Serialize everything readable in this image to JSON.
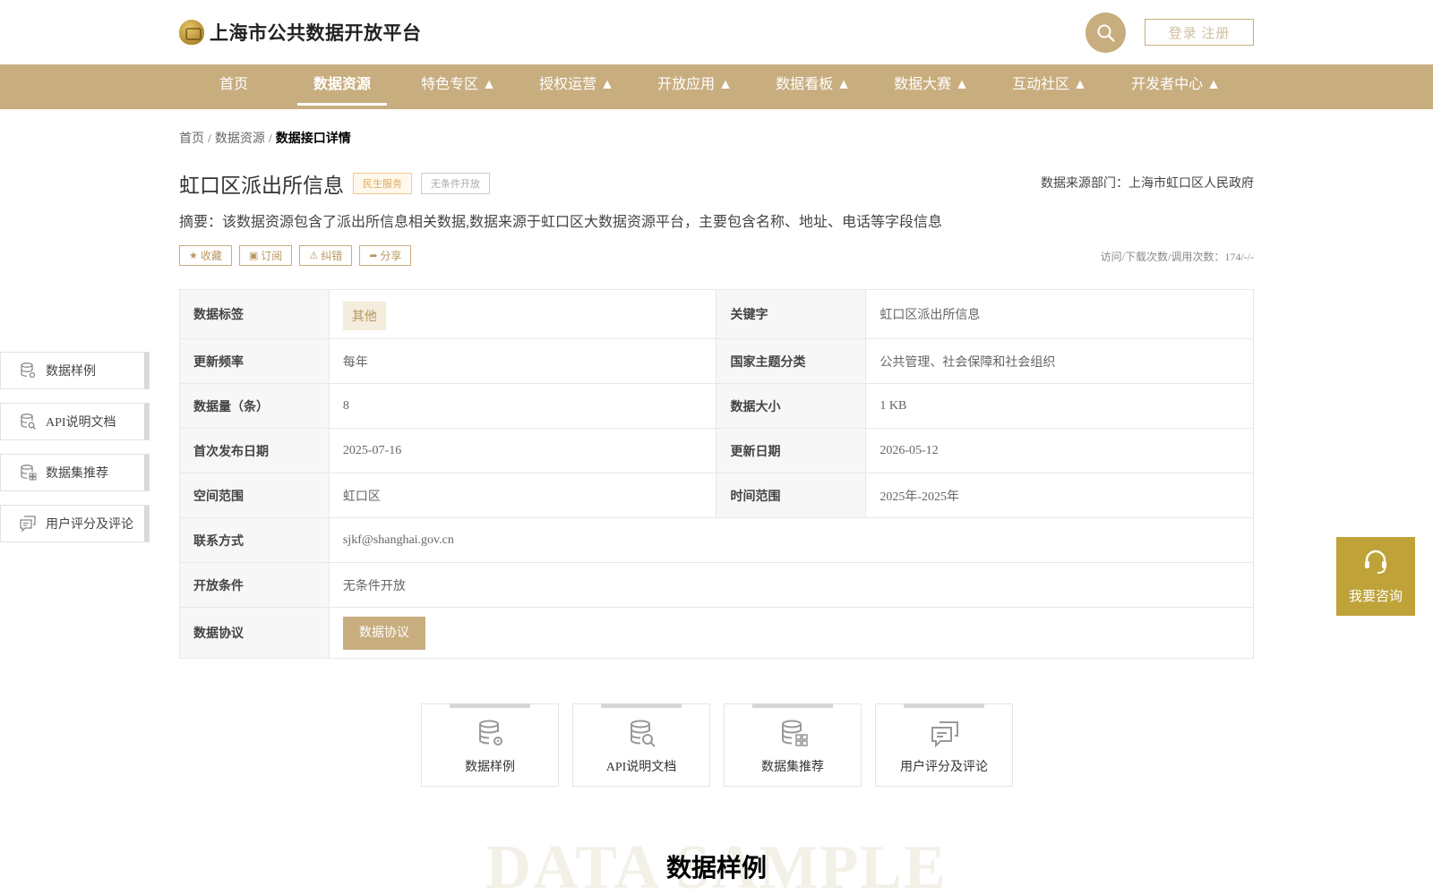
{
  "header": {
    "site_title": "上海市公共数据开放平台",
    "login_label": "登录 注册"
  },
  "nav": {
    "items": [
      {
        "label": "首页"
      },
      {
        "label": "数据资源"
      },
      {
        "label": "特色专区 ▲"
      },
      {
        "label": "授权运营 ▲"
      },
      {
        "label": "开放应用 ▲"
      },
      {
        "label": "数据看板 ▲"
      },
      {
        "label": "数据大赛 ▲"
      },
      {
        "label": "互动社区 ▲"
      },
      {
        "label": "开发者中心 ▲"
      }
    ],
    "active_index": 1
  },
  "breadcrumb": {
    "items": [
      "首页",
      "数据资源",
      "数据接口详情"
    ],
    "separator": "/"
  },
  "dataset": {
    "title": "虹口区派出所信息",
    "tag_service": "民生服务",
    "tag_open": "无条件开放",
    "source": "数据来源部门：上海市虹口区人民政府",
    "summary": "摘要：该数据资源包含了派出所信息相关数据,数据来源于虹口区大数据资源平台，主要包含名称、地址、电话等字段信息",
    "stats": "访问/下载次数/调用次数：174/-/-"
  },
  "actions": {
    "favorite": "收藏",
    "subscribe": "订阅",
    "report": "纠错",
    "share": "分享"
  },
  "info": {
    "label_tag": "数据标签",
    "value_tag": "其他",
    "label_keyword": "关键字",
    "value_keyword": "虹口区派出所信息",
    "label_freq": "更新频率",
    "value_freq": "每年",
    "label_theme": "国家主题分类",
    "value_theme": "公共管理、社会保障和社会组织",
    "label_count": "数据量（条）",
    "value_count": "8",
    "label_size": "数据大小",
    "value_size": "1 KB",
    "label_first": "首次发布日期",
    "value_first": "2025-07-16",
    "label_updated": "更新日期",
    "value_updated": "2026-05-12",
    "label_space": "空间范围",
    "value_space": "虹口区",
    "label_time": "时间范围",
    "value_time": "2025年-2025年",
    "label_contact": "联系方式",
    "value_contact": "sjkf@shanghai.gov.cn",
    "label_condition": "开放条件",
    "value_condition": "无条件开放",
    "label_agreement": "数据协议",
    "agreement_button": "数据协议"
  },
  "side_tabs": [
    {
      "label": "数据样例"
    },
    {
      "label": "API说明文档"
    },
    {
      "label": "数据集推荐"
    },
    {
      "label": "用户评分及评论"
    }
  ],
  "cards": [
    {
      "label": "数据样例"
    },
    {
      "label": "API说明文档"
    },
    {
      "label": "数据集推荐"
    },
    {
      "label": "用户评分及评论"
    }
  ],
  "consult": {
    "label": "我要咨询"
  },
  "section": {
    "bg_word": "DATA SAMPLE",
    "title": "数据样例"
  },
  "colors": {
    "brand_gold": "#c8ad7f",
    "consult_gold": "#bfa339"
  },
  "icons": {
    "logo": "logo-emblem-icon",
    "search": "search-icon",
    "favorite": "star-icon",
    "subscribe": "bookmark-icon",
    "report": "warning-icon",
    "share": "share-icon",
    "sample": "database-gear-icon",
    "api": "database-search-icon",
    "recommend": "database-grid-icon",
    "comment": "chat-bubbles-icon",
    "consult": "headset-icon"
  }
}
